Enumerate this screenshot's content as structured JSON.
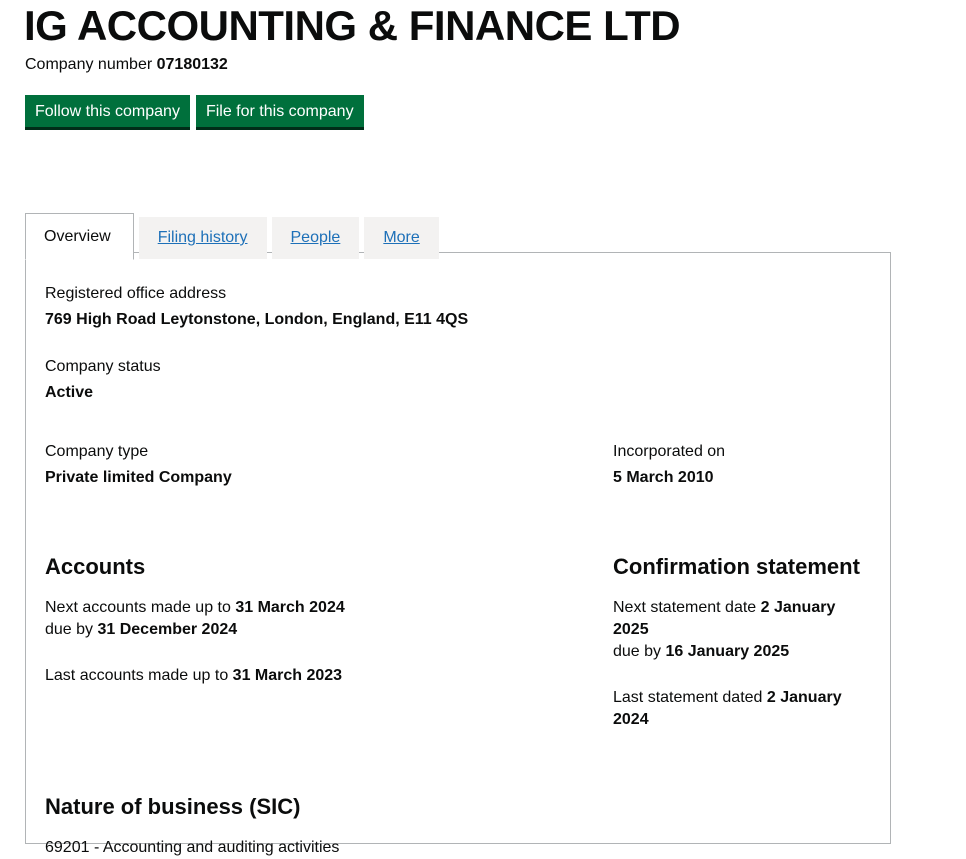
{
  "header": {
    "company_title": "IG ACCOUNTING & FINANCE LTD",
    "company_number_label": "Company number",
    "company_number_value": "07180132",
    "buttons": [
      {
        "label": "Follow this company",
        "name": "follow-this-company-button"
      },
      {
        "label": "File for this company",
        "name": "file-for-this-company-button"
      }
    ],
    "accent_color": "#00703c"
  },
  "tabs": [
    {
      "label": "Overview",
      "active": true
    },
    {
      "label": "Filing history",
      "active": false
    },
    {
      "label": "People",
      "active": false
    },
    {
      "label": "More",
      "active": false
    }
  ],
  "overview": {
    "registered_office_address": {
      "term": "Registered office address",
      "detail": "769 High Road Leytonstone, London, England, E11 4QS"
    },
    "company_status": {
      "term": "Company status",
      "detail": "Active"
    },
    "company_type": {
      "term": "Company type",
      "detail": "Private limited Company"
    },
    "incorporated_on": {
      "term": "Incorporated on",
      "detail": "5 March 2010"
    },
    "accounts": {
      "heading": "Accounts",
      "next_line1_prefix": "Next accounts made up to ",
      "next_line1_value": "31 March 2024",
      "next_line2_prefix": "due by ",
      "next_line2_value": "31 December 2024",
      "last_prefix": "Last accounts made up to ",
      "last_value": "31 March 2023"
    },
    "confirmation_statement": {
      "heading": "Confirmation statement",
      "next_line1_prefix": "Next statement date ",
      "next_line1_value": "2 January 2025",
      "next_line2_prefix": "due by ",
      "next_line2_value": "16 January 2025",
      "last_prefix": "Last statement dated ",
      "last_value": "2 January 2024"
    },
    "sic": {
      "heading": "Nature of business (SIC)",
      "items": [
        "69201 - Accounting and auditing activities"
      ]
    }
  }
}
